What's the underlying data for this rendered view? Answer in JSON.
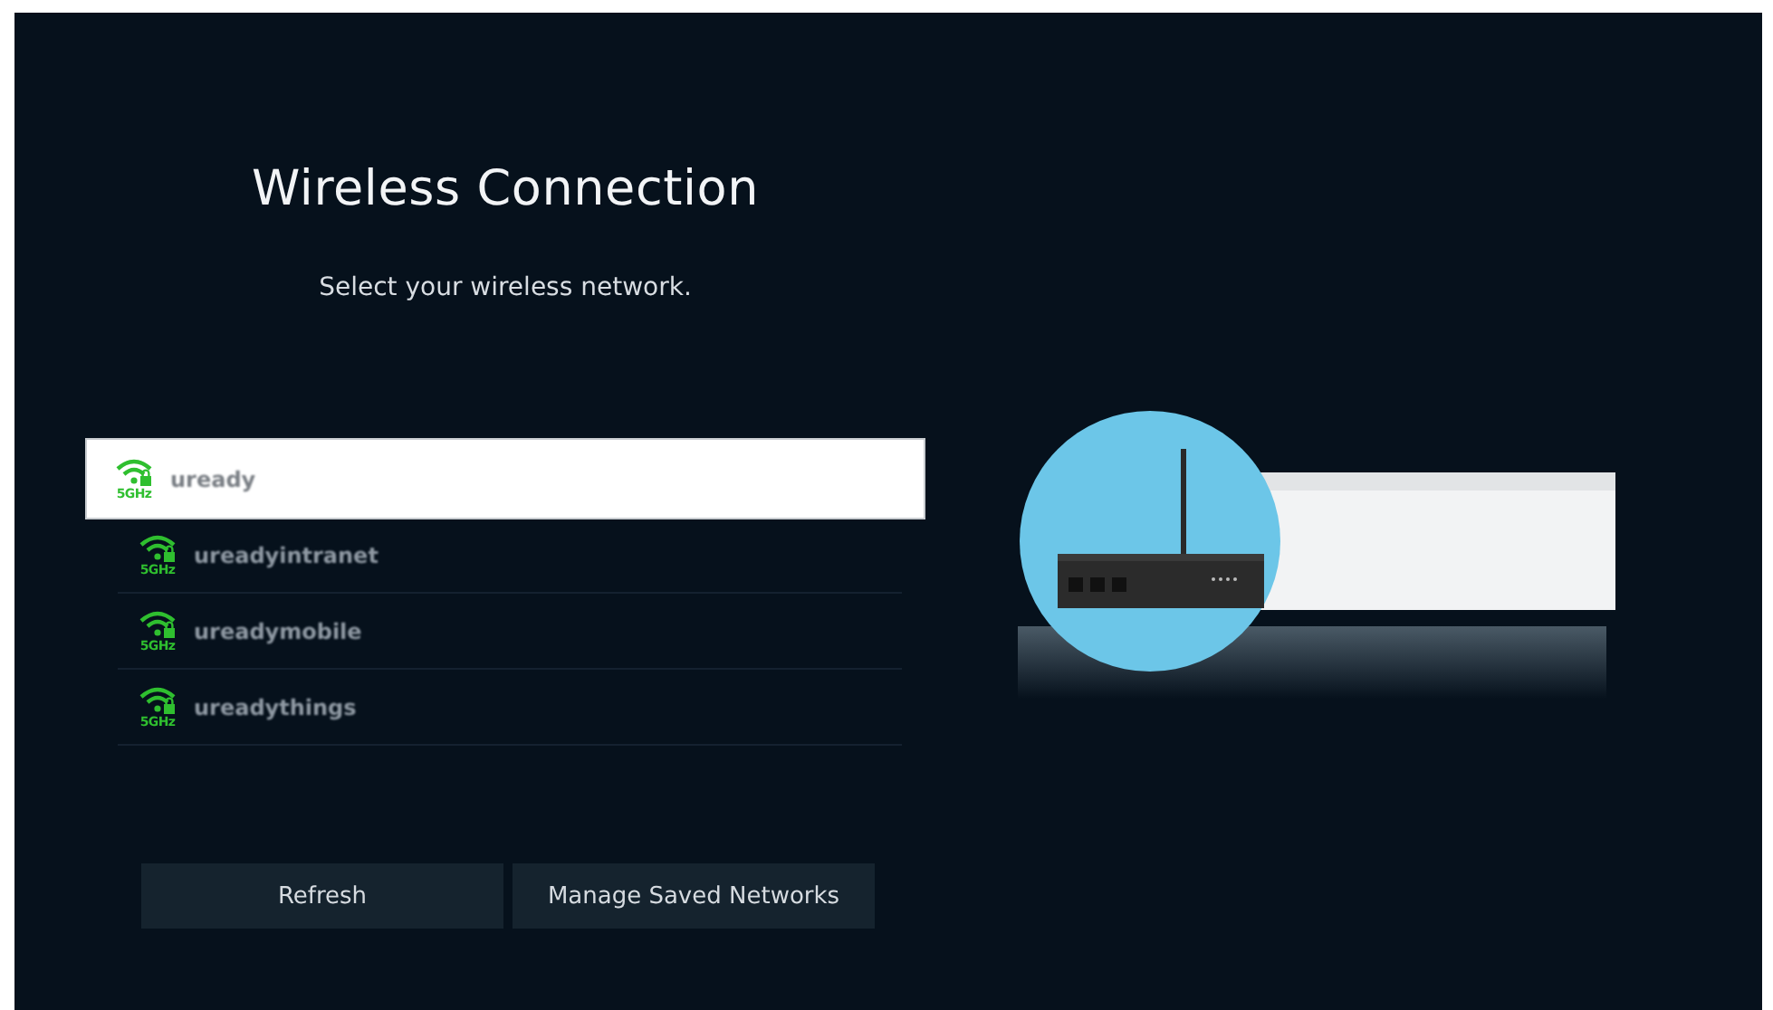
{
  "title": "Wireless Connection",
  "subtitle": "Select your wireless network.",
  "networks": [
    {
      "name": "uready",
      "band": "5GHz",
      "selected": true
    },
    {
      "name": "ureadyintranet",
      "band": "5GHz",
      "selected": false
    },
    {
      "name": "ureadymobile",
      "band": "5GHz",
      "selected": false
    },
    {
      "name": "ureadythings",
      "band": "5GHz",
      "selected": false
    }
  ],
  "buttons": [
    "Refresh",
    "Manage Saved Networks"
  ]
}
